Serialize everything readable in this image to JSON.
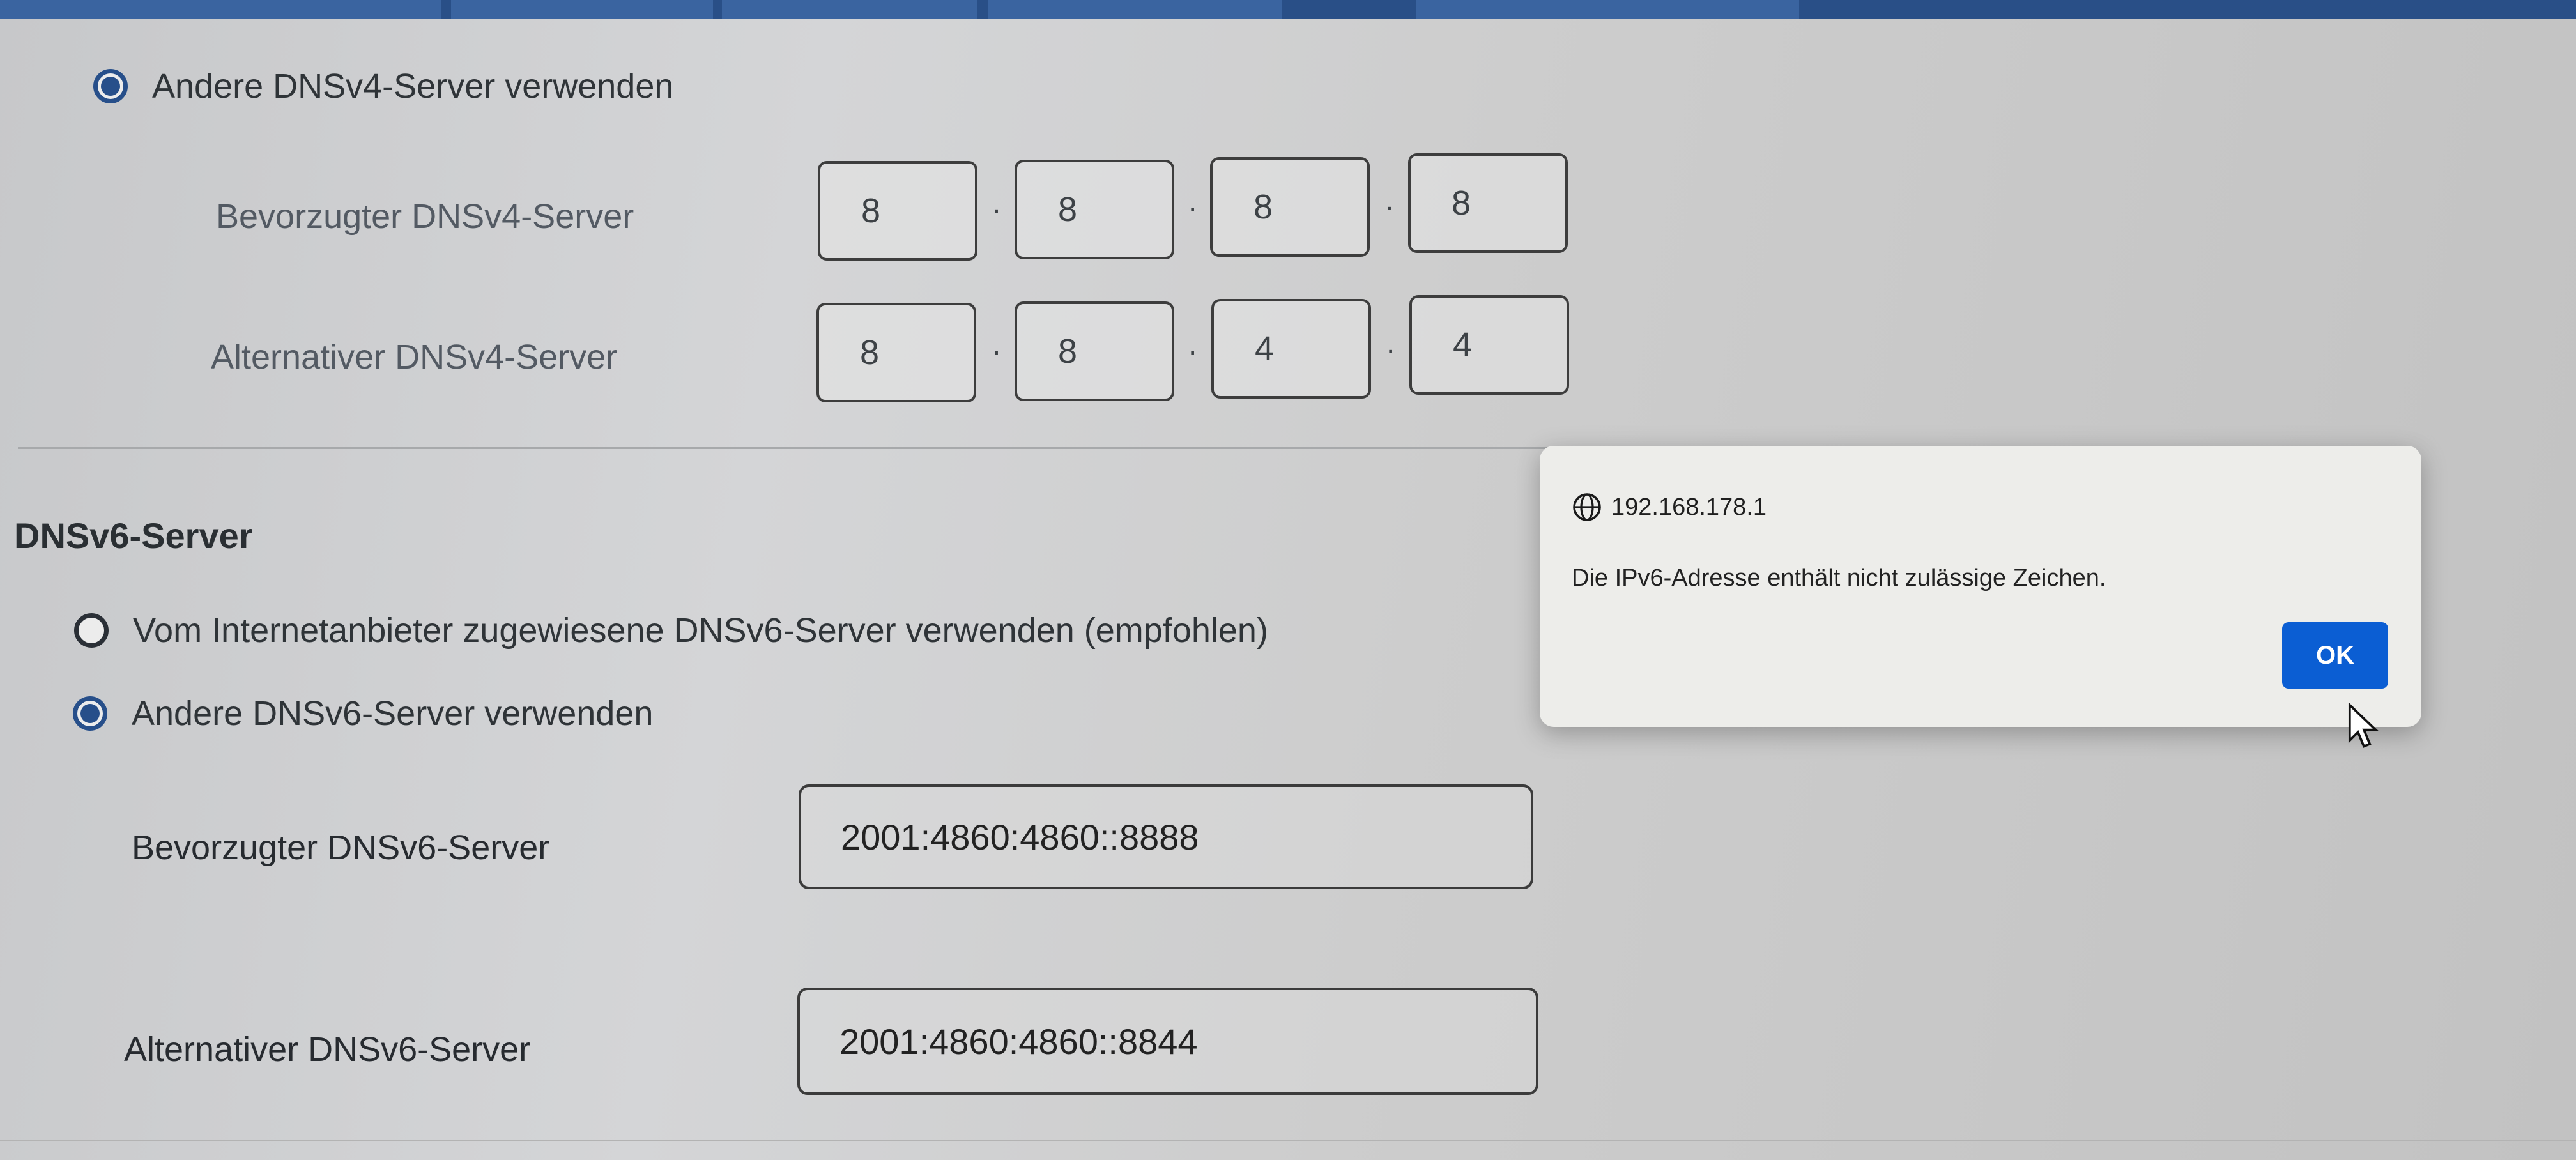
{
  "dnsv4": {
    "option_other_label": "Andere DNSv4-Server verwenden",
    "preferred_label": "Bevorzugter DNSv4-Server",
    "alternative_label": "Alternativer DNSv4-Server",
    "preferred_octets": [
      "8",
      "8",
      "8",
      "8"
    ],
    "alternative_octets": [
      "8",
      "8",
      "4",
      "4"
    ],
    "separator": "."
  },
  "dnsv6": {
    "section_title": "DNSv6-Server",
    "option_isp_label": "Vom Internetanbieter zugewiesene DNSv6-Server verwenden (empfohlen)",
    "option_other_label": "Andere DNSv6-Server verwenden",
    "preferred_label": "Bevorzugter DNSv6-Server",
    "preferred_value": "2001:4860:4860::8888",
    "alternative_label": "Alternativer DNSv6-Server",
    "alternative_value": "2001:4860:4860::8844"
  },
  "dialog": {
    "origin": "192.168.178.1",
    "message": "Die IPv6-Adresse enthält nicht zulässige Zeichen.",
    "ok_label": "OK",
    "icon": "globe-icon"
  },
  "colors": {
    "accent": "#274f8a",
    "ok_button": "#0b5ed3",
    "top_bar": "#294f87"
  }
}
